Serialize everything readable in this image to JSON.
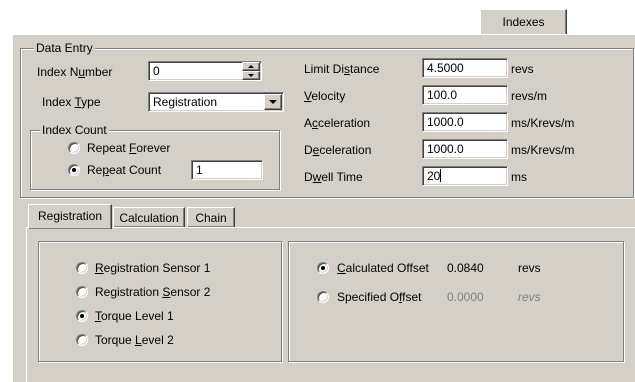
{
  "top_tab": {
    "label": "Indexes"
  },
  "data_entry": {
    "caption": "Data Entry",
    "index_number": {
      "label_pre": "Index N",
      "label_u": "u",
      "label_post": "mber",
      "value": "0"
    },
    "index_type": {
      "label_pre": "Index ",
      "label_u": "T",
      "label_post": "ype",
      "value": "Registration"
    },
    "index_count": {
      "caption": "Index Count",
      "repeat_forever": {
        "pre": "Repeat ",
        "u": "F",
        "post": "orever",
        "selected": false
      },
      "repeat_count": {
        "pre": "Re",
        "u": "p",
        "post": "eat Count",
        "selected": true,
        "value": "1"
      }
    },
    "params": [
      {
        "label_pre": "Limit Di",
        "label_u": "s",
        "label_post": "tance",
        "value": "4.5000",
        "unit": "revs"
      },
      {
        "label_pre": "",
        "label_u": "V",
        "label_post": "elocity",
        "value": "100.0",
        "unit": "revs/m"
      },
      {
        "label_pre": "A",
        "label_u": "c",
        "label_post": "celeration",
        "value": "1000.0",
        "unit": "ms/Krevs/m"
      },
      {
        "label_pre": "D",
        "label_u": "e",
        "label_post": "celeration",
        "value": "1000.0",
        "unit": "ms/Krevs/m"
      },
      {
        "label_pre": "D",
        "label_u": "w",
        "label_post": "ell Time",
        "value": "20",
        "unit": "ms"
      }
    ]
  },
  "bottom_tabs": [
    {
      "label": "Registration",
      "active": true
    },
    {
      "label": "Calculation",
      "active": false
    },
    {
      "label": "Chain",
      "active": false
    }
  ],
  "registration": {
    "sources": [
      {
        "pre": "",
        "u": "R",
        "post": "egistration Sensor 1",
        "selected": false
      },
      {
        "pre": "Registration ",
        "u": "S",
        "post": "ensor 2",
        "selected": false
      },
      {
        "pre": "",
        "u": "T",
        "post": "orque Level 1",
        "selected": true
      },
      {
        "pre": "Torque ",
        "u": "L",
        "post": "evel 2",
        "selected": false
      }
    ],
    "offsets": [
      {
        "pre": "",
        "u": "C",
        "post": "alculated Offset",
        "value": "0.0840",
        "unit": "revs",
        "selected": true,
        "enabled": true
      },
      {
        "pre": "Specified O",
        "u": "f",
        "post": "fset",
        "value": "0.0000",
        "unit": "revs",
        "selected": false,
        "enabled": false
      }
    ]
  }
}
